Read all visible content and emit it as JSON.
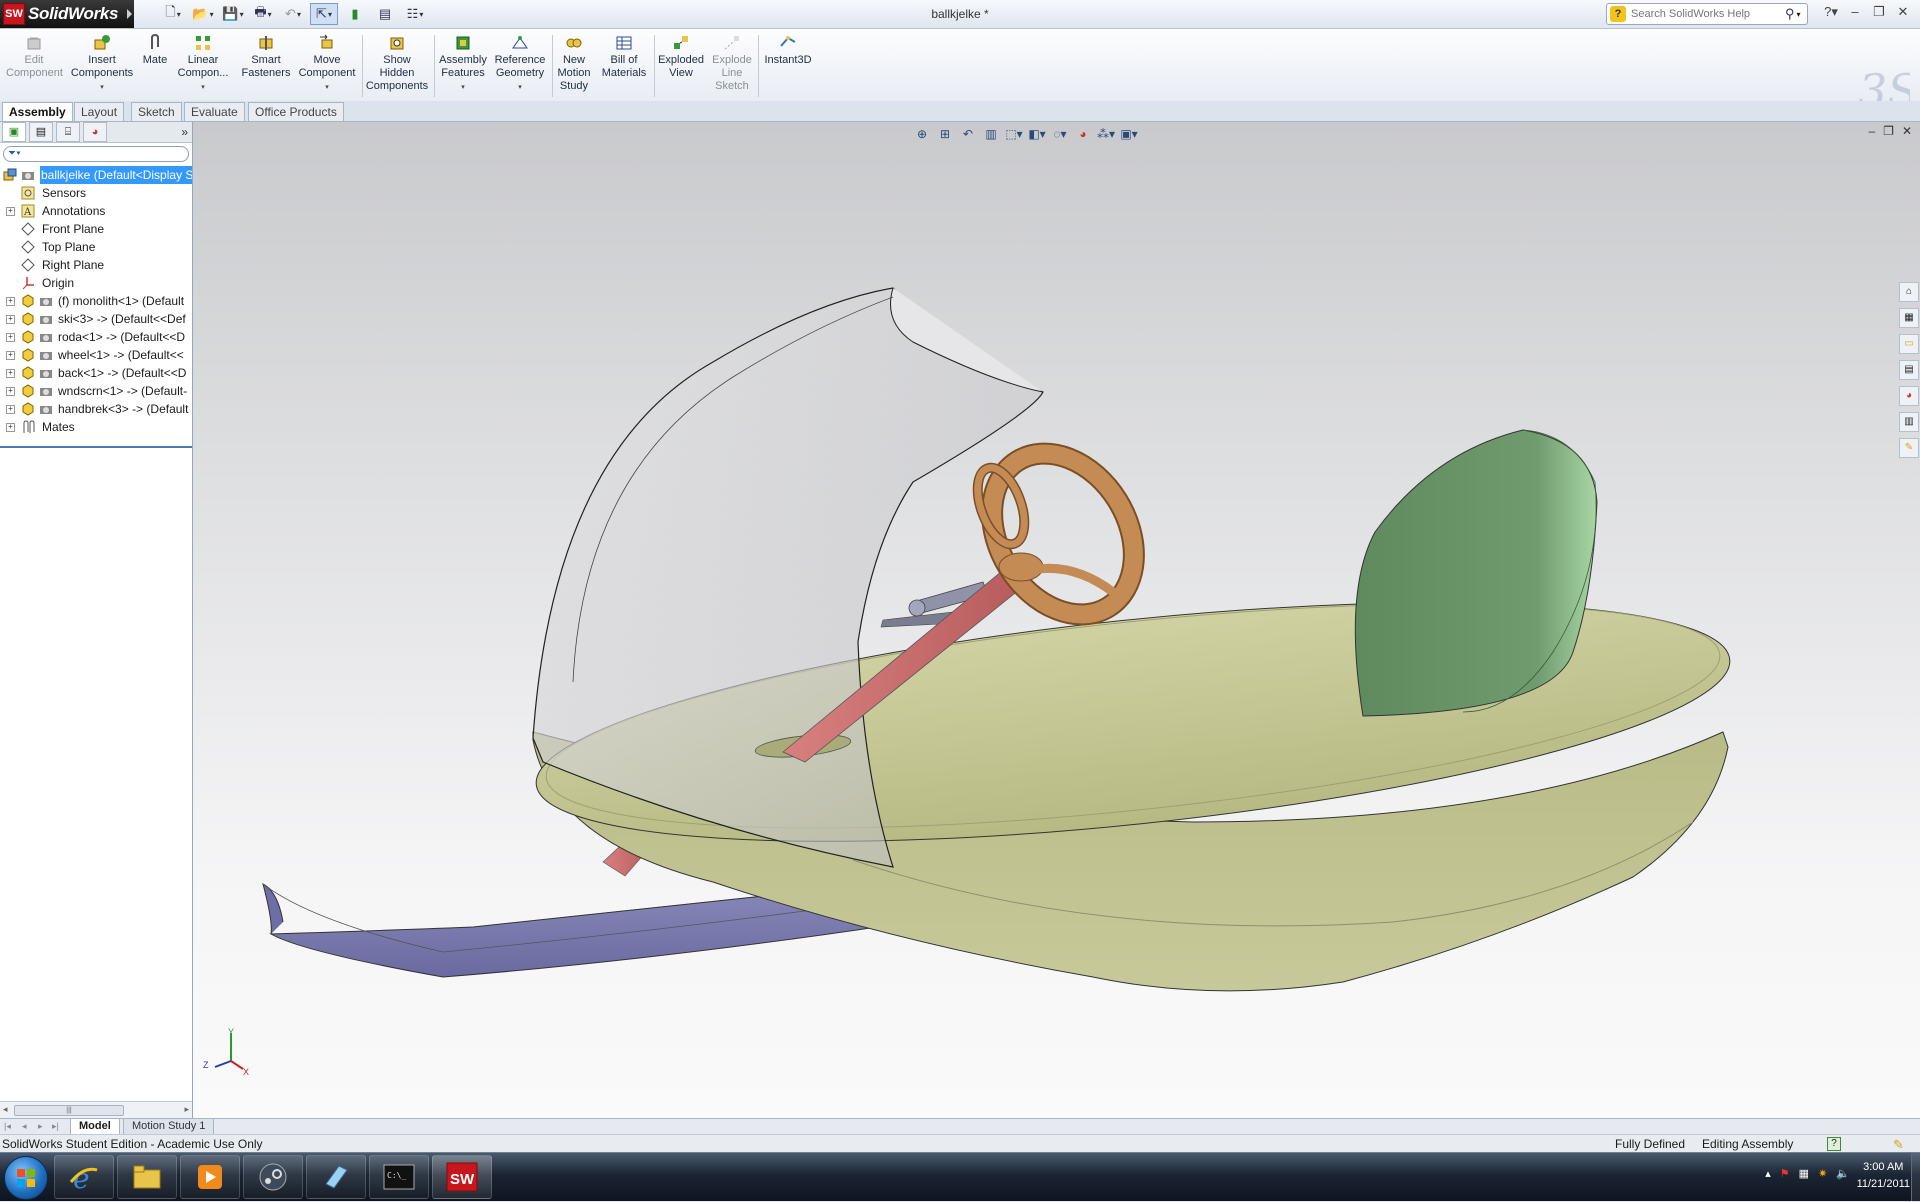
{
  "app": {
    "logo_text": "SolidWorks",
    "document_title": "ballkjelke *"
  },
  "search": {
    "placeholder": "Search SolidWorks Help"
  },
  "command_manager": {
    "items": [
      {
        "label": "Edit Component",
        "lines": [
          "Edit",
          "Component"
        ]
      },
      {
        "label": "Insert Components",
        "lines": [
          "Insert",
          "Components"
        ]
      },
      {
        "label": "Mate",
        "lines": [
          "Mate"
        ]
      },
      {
        "label": "Linear Component Pattern",
        "lines": [
          "Linear",
          "Compon..."
        ]
      },
      {
        "label": "Smart Fasteners",
        "lines": [
          "Smart",
          "Fasteners"
        ]
      },
      {
        "label": "Move Component",
        "lines": [
          "Move",
          "Component"
        ]
      },
      {
        "label": "Show Hidden Components",
        "lines": [
          "Show",
          "Hidden",
          "Components"
        ]
      },
      {
        "label": "Assembly Features",
        "lines": [
          "Assembly",
          "Features"
        ]
      },
      {
        "label": "Reference Geometry",
        "lines": [
          "Reference",
          "Geometry"
        ]
      },
      {
        "label": "New Motion Study",
        "lines": [
          "New",
          "Motion",
          "Study"
        ]
      },
      {
        "label": "Bill of Materials",
        "lines": [
          "Bill of",
          "Materials"
        ]
      },
      {
        "label": "Exploded View",
        "lines": [
          "Exploded",
          "View"
        ]
      },
      {
        "label": "Explode Line Sketch",
        "lines": [
          "Explode",
          "Line",
          "Sketch"
        ]
      },
      {
        "label": "Instant3D",
        "lines": [
          "Instant3D"
        ]
      }
    ]
  },
  "tabs": [
    "Assembly",
    "Layout",
    "Sketch",
    "Evaluate",
    "Office Products"
  ],
  "feature_tree": {
    "root": "ballkjelke  (Default<Display S",
    "items": [
      {
        "label": "Sensors",
        "icon": "sensor-icon",
        "expandable": false
      },
      {
        "label": "Annotations",
        "icon": "annotations-icon",
        "expandable": true
      },
      {
        "label": "Front Plane",
        "icon": "plane-icon",
        "expandable": false
      },
      {
        "label": "Top Plane",
        "icon": "plane-icon",
        "expandable": false
      },
      {
        "label": "Right Plane",
        "icon": "plane-icon",
        "expandable": false
      },
      {
        "label": "Origin",
        "icon": "origin-icon",
        "expandable": false
      },
      {
        "label": "(f) monolith<1> (Default",
        "icon": "part-icon",
        "expandable": true
      },
      {
        "label": "ski<3> -> (Default<<Def",
        "icon": "part-icon",
        "expandable": true
      },
      {
        "label": "roda<1> -> (Default<<D",
        "icon": "part-icon",
        "expandable": true
      },
      {
        "label": "wheel<1> -> (Default<<",
        "icon": "part-icon",
        "expandable": true
      },
      {
        "label": "back<1> -> (Default<<D",
        "icon": "part-icon",
        "expandable": true
      },
      {
        "label": "wndscrn<1> -> (Default-",
        "icon": "part-icon",
        "expandable": true
      },
      {
        "label": "handbrek<3> -> (Default",
        "icon": "part-icon",
        "expandable": true
      },
      {
        "label": "Mates",
        "icon": "mates-icon",
        "expandable": true
      }
    ]
  },
  "bottom_tabs": [
    "Model",
    "Motion Study 1"
  ],
  "status": {
    "edition": "SolidWorks Student Edition - Academic Use Only",
    "definition": "Fully Defined",
    "mode": "Editing Assembly",
    "help": "?"
  },
  "clock": {
    "time": "3:00 AM",
    "date": "11/21/2011"
  },
  "colors": {
    "body_top": "#c3c592",
    "body_rim": "#b2b47e",
    "ski": "#8484b4",
    "back": "#6f9a6f",
    "wheel": "#bf8a55",
    "column": "#c97070",
    "selection": "#3399ff"
  }
}
